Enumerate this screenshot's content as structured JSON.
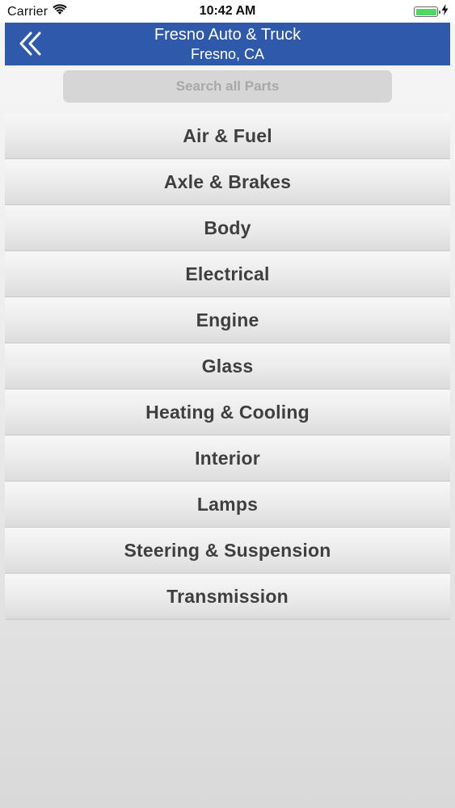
{
  "status_bar": {
    "carrier": "Carrier",
    "time": "10:42 AM",
    "battery_color": "#4cd964"
  },
  "header": {
    "title": "Fresno Auto & Truck",
    "subtitle": "Fresno, CA",
    "back_icon": "double-chevron-left-icon",
    "background_color": "#2f5aab"
  },
  "search": {
    "placeholder": "Search all Parts",
    "value": ""
  },
  "categories": [
    {
      "label": "Air & Fuel"
    },
    {
      "label": "Axle & Brakes"
    },
    {
      "label": "Body"
    },
    {
      "label": "Electrical"
    },
    {
      "label": "Engine"
    },
    {
      "label": "Glass"
    },
    {
      "label": "Heating & Cooling"
    },
    {
      "label": "Interior"
    },
    {
      "label": "Lamps"
    },
    {
      "label": "Steering & Suspension"
    },
    {
      "label": "Transmission"
    }
  ]
}
